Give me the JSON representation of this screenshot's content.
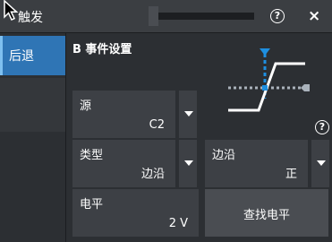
{
  "window": {
    "title": "触发",
    "help_label": "?",
    "close_label": "×"
  },
  "sidebar": {
    "back_label": "后退"
  },
  "section": {
    "title": "B 事件设置"
  },
  "fields": {
    "source": {
      "label": "源",
      "value": "C2"
    },
    "type": {
      "label": "类型",
      "value": "边沿"
    },
    "edge": {
      "label": "边沿",
      "value": "正"
    },
    "level": {
      "label": "电平",
      "value": "2 V"
    }
  },
  "find_level_button": "查找电平",
  "help2_label": "?",
  "colors": {
    "accent": "#2f75b5",
    "trigger_marker": "#1e8fe0",
    "panel": "#3d4045",
    "background": "#2c2f33"
  },
  "icons": {
    "help": "help-circle-icon",
    "close": "close-icon",
    "dropdown": "chevron-down-icon",
    "cursor": "mouse-pointer-icon"
  }
}
